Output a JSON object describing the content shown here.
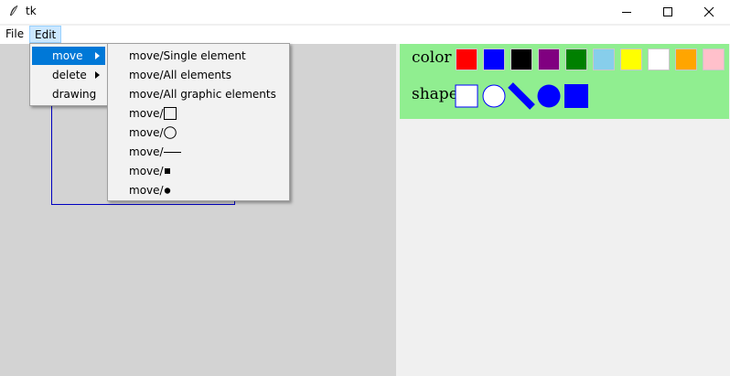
{
  "window": {
    "title": "tk",
    "minimize_icon": "minimize-icon",
    "maximize_icon": "maximize-icon",
    "close_icon": "close-icon"
  },
  "menubar": {
    "items": [
      {
        "label": "File"
      },
      {
        "label": "Edit"
      }
    ]
  },
  "edit_menu": {
    "items": [
      {
        "label": "move",
        "selected": true
      },
      {
        "label": "delete"
      },
      {
        "label": "drawing"
      }
    ]
  },
  "move_submenu": {
    "items": [
      {
        "label": "move/Single element"
      },
      {
        "label": "move/All elements"
      },
      {
        "label": "move/All graphic elements"
      },
      {
        "label": "move/",
        "glyph": "square-outline-icon"
      },
      {
        "label": "move/",
        "glyph": "circle-outline-icon"
      },
      {
        "label": "move/",
        "glyph": "line-icon"
      },
      {
        "label": "move/",
        "glyph": "filled-square-icon"
      },
      {
        "label": "move/",
        "glyph": "filled-circle-icon"
      }
    ]
  },
  "palette": {
    "color_label": "color",
    "shape_label": "shape",
    "colors": [
      "#ff0000",
      "#0000ff",
      "#000000",
      "#800080",
      "#008000",
      "#87ceeb",
      "#ffff00",
      "#ffffff",
      "#ffa500",
      "#ffc0cb"
    ],
    "shapes": [
      "square-outline-icon",
      "circle-outline-icon",
      "line-icon",
      "filled-circle-icon",
      "filled-square-icon"
    ],
    "shape_color": "#0000ff",
    "background": "#90ee90"
  },
  "canvas": {
    "background": "#d3d3d3",
    "rect_outline_color": "#0000c0"
  }
}
